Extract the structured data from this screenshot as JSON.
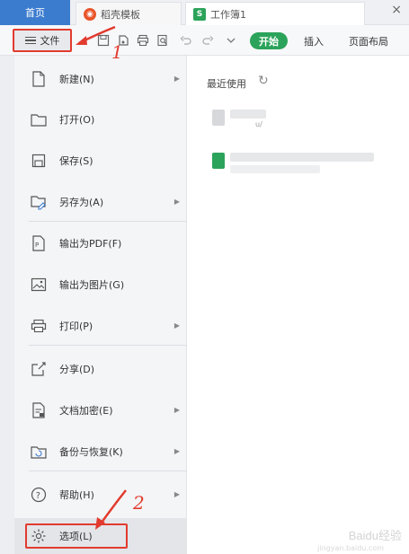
{
  "tabs": {
    "home": "首页",
    "template": "稻壳模板",
    "workbook": "工作簿1",
    "close": "×"
  },
  "toolbar": {
    "file": "文件",
    "start": "开始",
    "insert": "插入",
    "layout": "页面布局"
  },
  "menu": {
    "new": "新建(N)",
    "open": "打开(O)",
    "save": "保存(S)",
    "save_as": "另存为(A)",
    "export_pdf": "输出为PDF(F)",
    "export_image": "输出为图片(G)",
    "print": "打印(P)",
    "share": "分享(D)",
    "encrypt": "文档加密(E)",
    "backup": "备份与恢复(K)",
    "help": "帮助(H)",
    "options": "选项(L)"
  },
  "recent": {
    "title": "最近使用",
    "path_fragment": "u/"
  },
  "annotations": {
    "one": "1",
    "two": "2"
  },
  "watermark": {
    "text": "Baidu经验",
    "sub": "jingyan.baidu.com"
  },
  "colors": {
    "accent_red": "#e23b2e",
    "wps_green": "#2ba35a",
    "home_tab_blue": "#3c7ccf"
  }
}
